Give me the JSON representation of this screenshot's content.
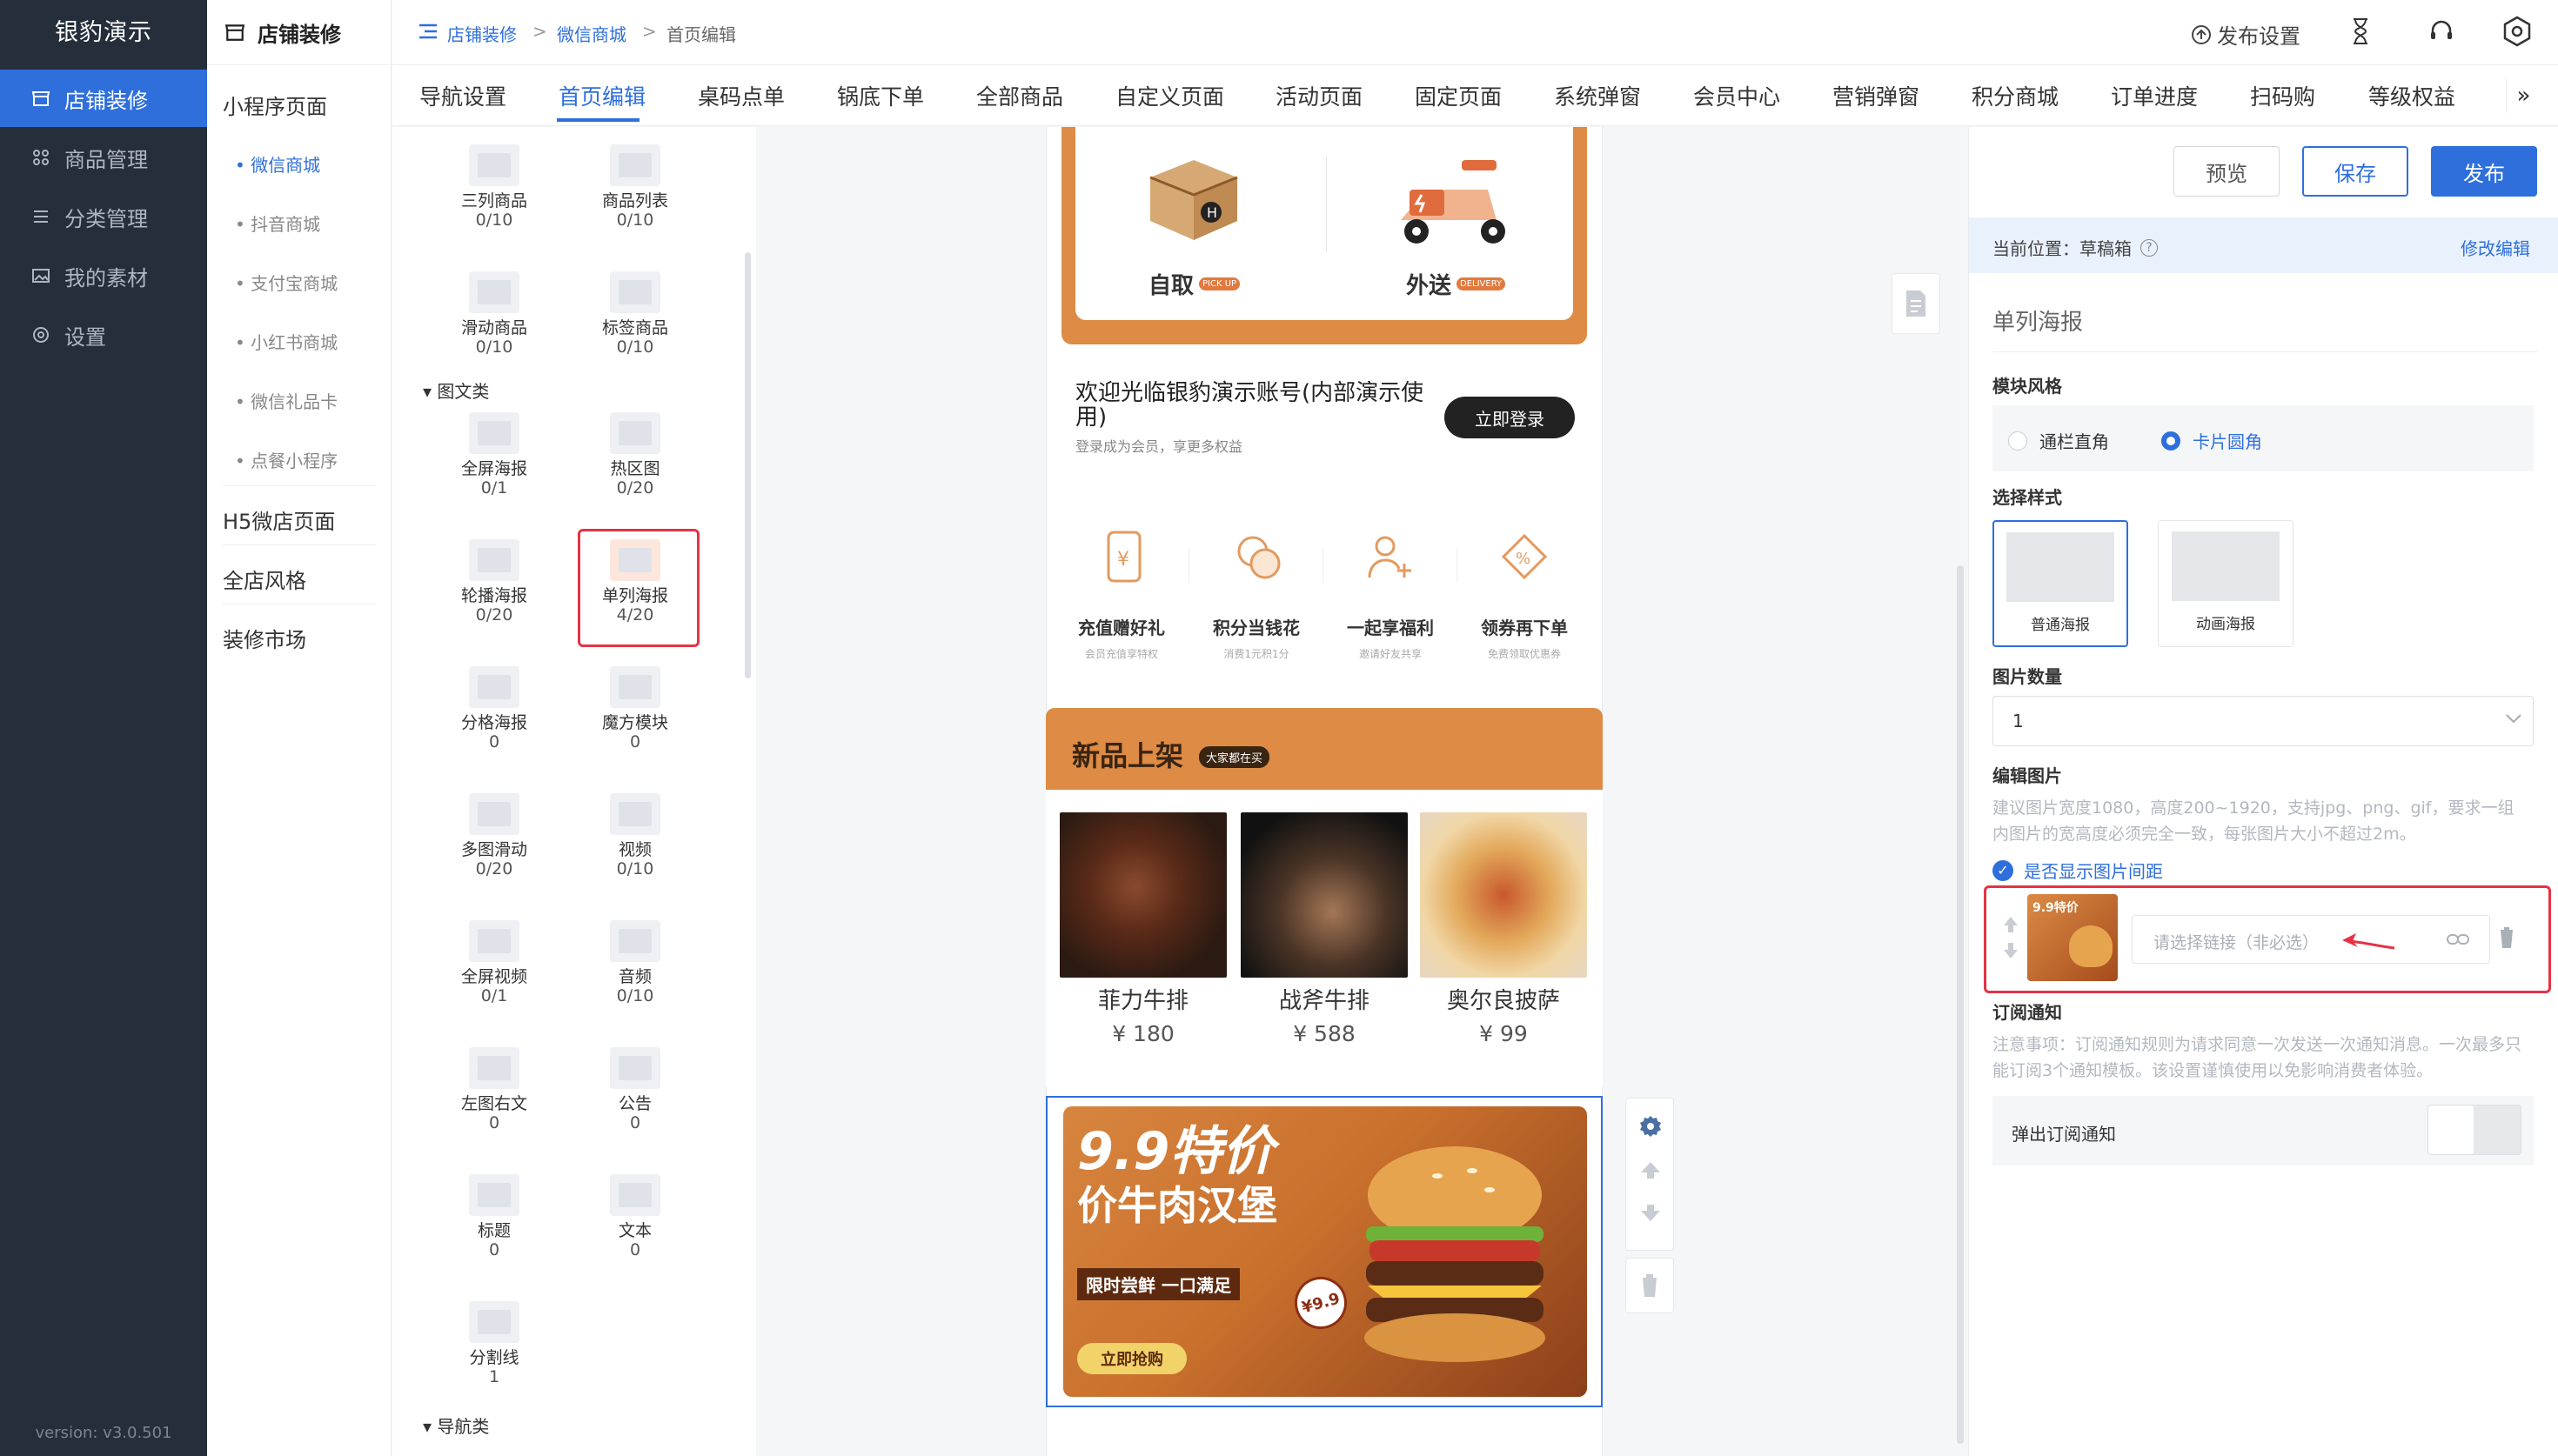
{
  "app": {
    "brand": "银豹演示",
    "version": "version: v3.0.501"
  },
  "sidebar": {
    "items": [
      {
        "label": "店铺装修",
        "icon": "store-icon"
      },
      {
        "label": "商品管理",
        "icon": "grid-icon"
      },
      {
        "label": "分类管理",
        "icon": "list-icon"
      },
      {
        "label": "我的素材",
        "icon": "image-icon"
      },
      {
        "label": "设置",
        "icon": "gear-icon"
      }
    ]
  },
  "subnav": {
    "title": "店铺装修",
    "items": [
      {
        "label": "小程序页面"
      },
      {
        "label": "微信商城"
      },
      {
        "label": "抖音商城"
      },
      {
        "label": "支付宝商城"
      },
      {
        "label": "小红书商城"
      },
      {
        "label": "微信礼品卡"
      },
      {
        "label": "点餐小程序"
      },
      {
        "label": "H5微店页面"
      },
      {
        "label": "全店风格"
      },
      {
        "label": "装修市场"
      }
    ]
  },
  "breadcrumb": {
    "items": [
      "店铺装修",
      "微信商城",
      "首页编辑"
    ],
    "sep": ">"
  },
  "topbar": {
    "publish_settings": "发布设置"
  },
  "tabs": [
    "导航设置",
    "首页编辑",
    "桌码点单",
    "锅底下单",
    "全部商品",
    "自定义页面",
    "活动页面",
    "固定页面",
    "系统弹窗",
    "会员中心",
    "营销弹窗",
    "积分商城",
    "订单进度",
    "扫码购",
    "等级权益"
  ],
  "components": {
    "group_tuwen": "图文类",
    "group_nav": "导航类",
    "items": [
      {
        "name": "三列商品",
        "count": "0/10"
      },
      {
        "name": "商品列表",
        "count": "0/10"
      },
      {
        "name": "滑动商品",
        "count": "0/10"
      },
      {
        "name": "标签商品",
        "count": "0/10"
      },
      {
        "name": "全屏海报",
        "count": "0/1"
      },
      {
        "name": "热区图",
        "count": "0/20"
      },
      {
        "name": "轮播海报",
        "count": "0/20"
      },
      {
        "name": "单列海报",
        "count": "4/20"
      },
      {
        "name": "分格海报",
        "count": "0"
      },
      {
        "name": "魔方模块",
        "count": "0"
      },
      {
        "name": "多图滑动",
        "count": "0/20"
      },
      {
        "name": "视频",
        "count": "0/10"
      },
      {
        "name": "全屏视频",
        "count": "0/1"
      },
      {
        "name": "音频",
        "count": "0/10"
      },
      {
        "name": "左图右文",
        "count": "0"
      },
      {
        "name": "公告",
        "count": "0"
      },
      {
        "name": "标题",
        "count": "0"
      },
      {
        "name": "文本",
        "count": "0"
      },
      {
        "name": "分割线",
        "count": "1"
      }
    ]
  },
  "phone": {
    "delivery": {
      "pickup": "自取",
      "pickup_tag": "PICK UP",
      "deliver": "外送",
      "deliver_tag": "DELIVERY"
    },
    "welcome": {
      "title": "欢迎光临银豹演示账号(内部演示使用)",
      "sub": "登录成为会员，享更多权益",
      "login": "立即登录"
    },
    "perks": [
      {
        "title": "充值赠好礼",
        "sub": "会员充值享特权"
      },
      {
        "title": "积分当钱花",
        "sub": "消费1元积1分"
      },
      {
        "title": "一起享福利",
        "sub": "邀请好友共享"
      },
      {
        "title": "领券再下单",
        "sub": "免费领取优惠券"
      }
    ],
    "new": {
      "title": "新品上架",
      "tag": "大家都在买"
    },
    "products": [
      {
        "name": "菲力牛排",
        "price": "¥ 180"
      },
      {
        "name": "战斧牛排",
        "price": "¥ 588"
      },
      {
        "name": "奥尔良披萨",
        "price": "¥ 99"
      }
    ],
    "poster": {
      "line1": "9.9特价",
      "line2": "价牛肉汉堡",
      "line3": "限时尝鲜 一口满足",
      "cta": "立即抢购",
      "badge": "¥9.9"
    }
  },
  "right": {
    "preview": "预览",
    "save": "保存",
    "publish": "发布",
    "location_label": "当前位置：草稿箱",
    "edit": "修改编辑",
    "module_title": "单列海报",
    "style_label": "模块风格",
    "style_opt1": "通栏直角",
    "style_opt2": "卡片圆角",
    "choose_style": "选择样式",
    "opt_normal": "普通海报",
    "opt_anim": "动画海报",
    "count_label": "图片数量",
    "count_value": "1",
    "edit_label": "编辑图片",
    "edit_hint": "建议图片宽度1080，高度200~1920，支持jpg、png、gif，要求一组内图片的宽高度必须完全一致，每张图片大小不超过2m。",
    "spacing": "是否显示图片间距",
    "link_placeholder": "请选择链接（非必选）",
    "subscribe_label": "订阅通知",
    "subscribe_hint": "注意事项：订阅通知规则为请求同意一次发送一次通知消息。一次最多只能订阅3个通知模板。该设置谨慎使用以免影响消费者体验。",
    "popup": "弹出订阅通知"
  },
  "colors": {
    "primary": "#2e6fdc",
    "sidebar": "#252e3b",
    "orange": "#dd8b45",
    "red": "#e53345"
  }
}
